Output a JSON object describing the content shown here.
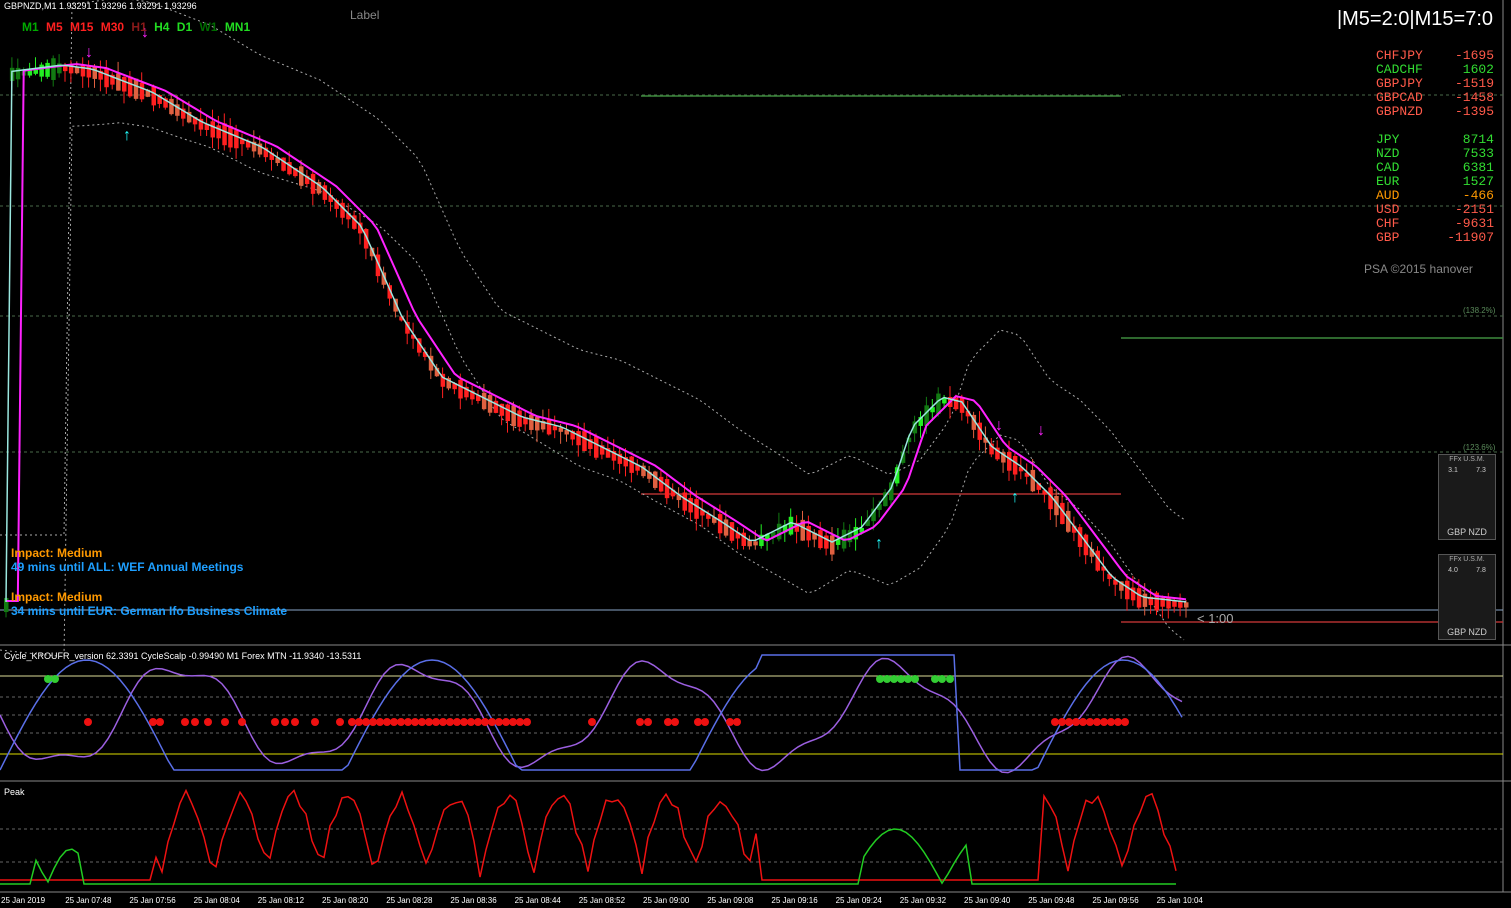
{
  "symbol_title": "GBPNZD,M1  1.93291 1.93296 1.93291 1.93296",
  "label_text": "Label",
  "timeframes": [
    {
      "label": "M1",
      "color": "#00aa00"
    },
    {
      "label": "M5",
      "color": "#ff2020"
    },
    {
      "label": "M15",
      "color": "#ff2020"
    },
    {
      "label": "M30",
      "color": "#ff2020"
    },
    {
      "label": "H1",
      "color": "#8b1a1a"
    },
    {
      "label": "H4",
      "color": "#22dd22"
    },
    {
      "label": "D1",
      "color": "#22dd22"
    },
    {
      "label": "W1",
      "color": "#006a00"
    },
    {
      "label": "MN1",
      "color": "#22dd22"
    }
  ],
  "signal_box": "|M5=2:0|M15=7:0",
  "pairs": [
    {
      "name": "CHFJPY",
      "value": "-1695",
      "color": "#ff5a4a"
    },
    {
      "name": "CADCHF",
      "value": "1602",
      "color": "#32dc32"
    },
    {
      "name": "GBPJPY",
      "value": "-1519",
      "color": "#ff5a4a"
    },
    {
      "name": "GBPCAD",
      "value": "-1458",
      "color": "#ff5a4a"
    },
    {
      "name": "GBPNZD",
      "value": "-1395",
      "color": "#ff5a4a"
    }
  ],
  "currencies": [
    {
      "name": "JPY",
      "value": "8714",
      "color": "#32dc32"
    },
    {
      "name": "NZD",
      "value": "7533",
      "color": "#32dc32"
    },
    {
      "name": "CAD",
      "value": "6381",
      "color": "#32dc32"
    },
    {
      "name": "EUR",
      "value": "1527",
      "color": "#32dc32"
    },
    {
      "name": "AUD",
      "value": "-466",
      "color": "#ff9900"
    },
    {
      "name": "USD",
      "value": "-2151",
      "color": "#ff5a4a"
    },
    {
      "name": "CHF",
      "value": "-9631",
      "color": "#ff5a4a"
    },
    {
      "name": "GBP",
      "value": "-11907",
      "color": "#ff5a4a"
    }
  ],
  "copyright": "PSA ©2015 hanover",
  "fib_levels": [
    "(138.2%)",
    "(123.6%)"
  ],
  "news": [
    {
      "impact": "Impact: Medium",
      "until": "49 mins until ALL: WEF Annual Meetings"
    },
    {
      "impact": "Impact: Medium",
      "until": "34 mins until EUR: German Ifo Business Climate"
    }
  ],
  "bar_timer": "< 1:00",
  "indicator1_title": "Cycle_KROUFR_version 62.3391  CycleScalp -0.99490  M1 Forex MTN  -11.9340 -13.5311",
  "indicator2_title": "Peak",
  "meters": [
    {
      "header": "FFx U.S.M.",
      "left": "3.1",
      "right": "7.3",
      "pair": "GBP NZD"
    },
    {
      "header": "FFx U.S.M.",
      "left": "4.0",
      "right": "7.8",
      "pair": "GBP NZD"
    }
  ],
  "time_axis": [
    "25 Jan 2019",
    "25 Jan 07:48",
    "25 Jan 07:56",
    "25 Jan 08:04",
    "25 Jan 08:12",
    "25 Jan 08:20",
    "25 Jan 08:28",
    "25 Jan 08:36",
    "25 Jan 08:44",
    "25 Jan 08:52",
    "25 Jan 09:00",
    "25 Jan 09:08",
    "25 Jan 09:16",
    "25 Jan 09:24",
    "25 Jan 09:32",
    "25 Jan 09:40",
    "25 Jan 09:48",
    "25 Jan 09:56",
    "25 Jan 10:04"
  ],
  "colors": {
    "bull": "#22ee22",
    "bull_dark": "#127a12",
    "bear": "#ff2020",
    "bear_dark": "#8b1010",
    "ma_fast": "#9be8e0",
    "ma_slow": "#ff22ff",
    "grid": "#4a6a4a",
    "panel_line": "#fff"
  }
}
